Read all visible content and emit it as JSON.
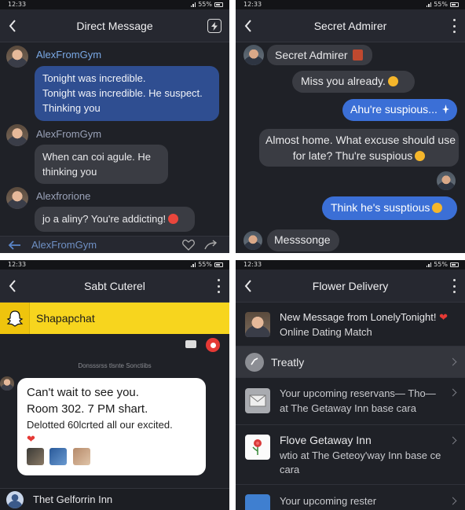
{
  "status": {
    "time": "12:33",
    "battery": "55%"
  },
  "panel1": {
    "title": "Direct Message",
    "messages": [
      {
        "sender": "AlexFromGym",
        "lines": [
          "Tonight was incredible.",
          "Tonight was incredible. He suspect.",
          "Thinking you"
        ]
      },
      {
        "sender": "AlexFromGym",
        "lines": [
          "When can coi agule. He",
          "thinking you"
        ]
      },
      {
        "sender": "Alexfrorione",
        "text": "jo a aliny? You're addicting!"
      }
    ],
    "footer_name": "AlexFromGym"
  },
  "panel2": {
    "title": "Secret Admirer",
    "header_chip": "Secret Admirer",
    "messages": [
      {
        "dir": "in",
        "text": "Miss you already."
      },
      {
        "dir": "out",
        "text": "Ahu're suspious..."
      },
      {
        "dir": "in",
        "lines": [
          "Almost home. What excuse should use",
          "for late? Thu're suspious"
        ]
      },
      {
        "dir": "out",
        "text": "Think he's susptious"
      }
    ],
    "composer_placeholder": "Messsonge"
  },
  "panel3": {
    "title": "Sabt Cuterel",
    "app_name": "Shapapchat",
    "system_note": "Donsssrss tlsnte Sonctiibs",
    "card": {
      "line1": "Can't wait to see you.",
      "line2": "Room 302. 7 PM shart.",
      "line3": "Delotted 60lcrted all our excited."
    },
    "footer_name": "Thet Gelforrin Inn"
  },
  "panel4": {
    "title": "Flower Delivery",
    "rows": [
      {
        "title": "New Message from LonelyTonight!",
        "sub": "Online Dating Match"
      },
      {
        "title": "Treatly"
      },
      {
        "title": "Your upcoming reservans— Tho—",
        "sub": "at The Getaway Inn base cara"
      },
      {
        "title": "Flove Getaway Inn",
        "sub": "wtio at The Geteoy'way Inn base ce",
        "sub2": "cara"
      },
      {
        "title": "Your upcoming rester"
      }
    ]
  }
}
